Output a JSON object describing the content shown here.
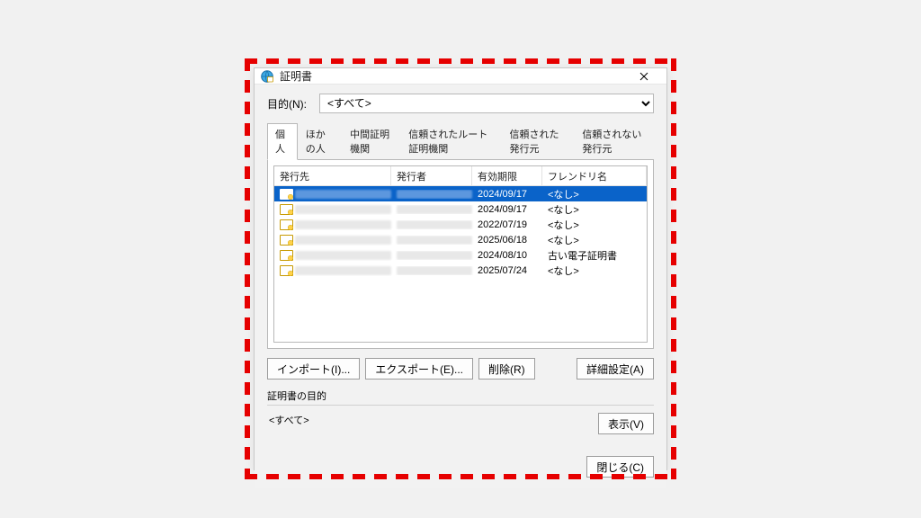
{
  "window": {
    "title": "証明書"
  },
  "purpose": {
    "label": "目的(N):",
    "selected": "<すべて>"
  },
  "tabs": [
    {
      "label": "個人",
      "active": true
    },
    {
      "label": "ほかの人"
    },
    {
      "label": "中間証明機関"
    },
    {
      "label": "信頼されたルート証明機関"
    },
    {
      "label": "信頼された発行元"
    },
    {
      "label": "信頼されない発行元"
    }
  ],
  "columns": {
    "issuedTo": "発行先",
    "issuer": "発行者",
    "expiry": "有効期限",
    "friendly": "フレンドリ名"
  },
  "rows": [
    {
      "selected": true,
      "expiry": "2024/09/17",
      "friendly": "<なし>"
    },
    {
      "selected": false,
      "expiry": "2024/09/17",
      "friendly": "<なし>"
    },
    {
      "selected": false,
      "expiry": "2022/07/19",
      "friendly": "<なし>"
    },
    {
      "selected": false,
      "expiry": "2025/06/18",
      "friendly": "<なし>"
    },
    {
      "selected": false,
      "expiry": "2024/08/10",
      "friendly": "古い電子証明書"
    },
    {
      "selected": false,
      "expiry": "2025/07/24",
      "friendly": "<なし>"
    }
  ],
  "buttons": {
    "import": "インポート(I)...",
    "export": "エクスポート(E)...",
    "remove": "削除(R)",
    "advanced": "詳細設定(A)",
    "view": "表示(V)",
    "close": "閉じる(C)"
  },
  "purposeGroup": {
    "label": "証明書の目的",
    "value": "<すべて>"
  }
}
